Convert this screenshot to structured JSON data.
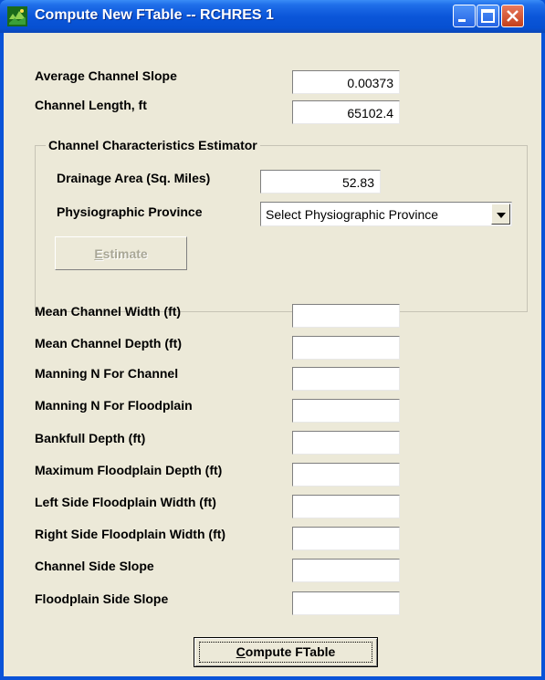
{
  "window": {
    "title": "Compute New FTable -- RCHRES 1"
  },
  "top_fields": [
    {
      "label": "Average Channel Slope",
      "value": "0.00373"
    },
    {
      "label": "Channel Length, ft",
      "value": "65102.4"
    }
  ],
  "estimator": {
    "title": "Channel Characteristics Estimator",
    "drainage_label": "Drainage Area (Sq. Miles)",
    "drainage_value": "52.83",
    "province_label": "Physiographic Province",
    "province_selected": "Select Physiographic Province",
    "estimate_button": {
      "accel": "E",
      "rest": "stimate"
    }
  },
  "params": [
    {
      "label": "Mean Channel Width (ft)",
      "value": ""
    },
    {
      "label": "Mean Channel Depth (ft)",
      "value": ""
    },
    {
      "label": "Manning N For Channel",
      "value": ""
    },
    {
      "label": "Manning N For Floodplain",
      "value": ""
    },
    {
      "label": "Bankfull Depth (ft)",
      "value": ""
    },
    {
      "label": "Maximum Floodplain Depth (ft)",
      "value": ""
    },
    {
      "label": "Left Side Floodplain Width (ft)",
      "value": ""
    },
    {
      "label": "Right Side Floodplain Width (ft)",
      "value": ""
    },
    {
      "label": "Channel Side Slope",
      "value": ""
    },
    {
      "label": "Floodplain Side Slope",
      "value": ""
    }
  ],
  "compute_button": {
    "accel": "C",
    "rest": "ompute FTable"
  }
}
